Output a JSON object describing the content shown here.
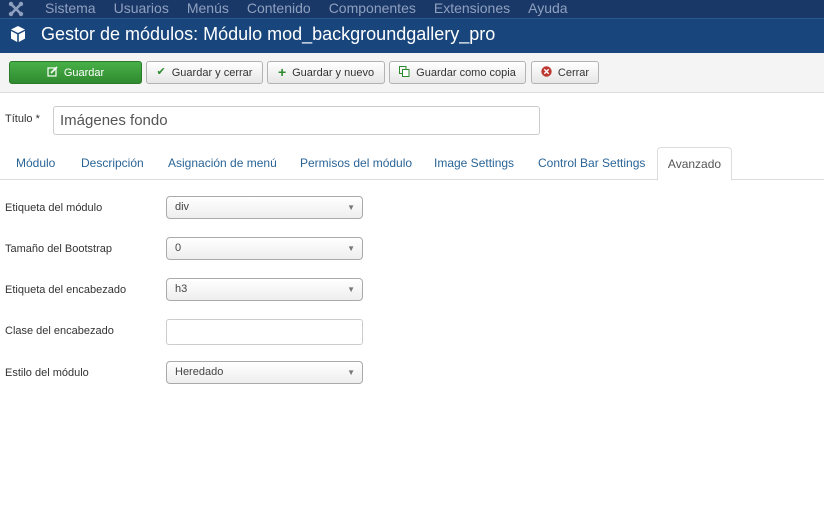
{
  "nav": {
    "items": [
      "Sistema",
      "Usuarios",
      "Menús",
      "Contenido",
      "Componentes",
      "Extensiones",
      "Ayuda"
    ]
  },
  "header": {
    "title": "Gestor de módulos: Módulo mod_backgroundgallery_pro"
  },
  "toolbar": {
    "save": "Guardar",
    "save_close": "Guardar y cerrar",
    "save_new": "Guardar y nuevo",
    "save_copy": "Guardar como copia",
    "close": "Cerrar"
  },
  "title_field": {
    "label": "Título *",
    "value": "Imágenes fondo"
  },
  "tabs": [
    "Módulo",
    "Descripción",
    "Asignación de menú",
    "Permisos del módulo",
    "Image Settings",
    "Control Bar Settings",
    "Avanzado"
  ],
  "active_tab": "Avanzado",
  "form": {
    "module_tag": {
      "label": "Etiqueta del módulo",
      "value": "div"
    },
    "bootstrap_size": {
      "label": "Tamaño del Bootstrap",
      "value": "0"
    },
    "header_tag": {
      "label": "Etiqueta del encabezado",
      "value": "h3"
    },
    "header_class": {
      "label": "Clase del encabezado",
      "value": ""
    },
    "module_style": {
      "label": "Estilo del módulo",
      "value": "Heredado"
    }
  },
  "colors": {
    "nav_bg": "#1a3867",
    "header_bg": "#18467c",
    "save_button": "#3a9d3a",
    "link": "#2a6496"
  },
  "icons": {
    "logo": "joomla-logo-icon",
    "header": "cube-icon",
    "save": "edit-icon",
    "save_close": "check-icon",
    "save_new": "plus-icon",
    "save_copy": "copy-icon",
    "close": "cancel-circle-icon",
    "select_arrow": "caret-down-icon"
  }
}
